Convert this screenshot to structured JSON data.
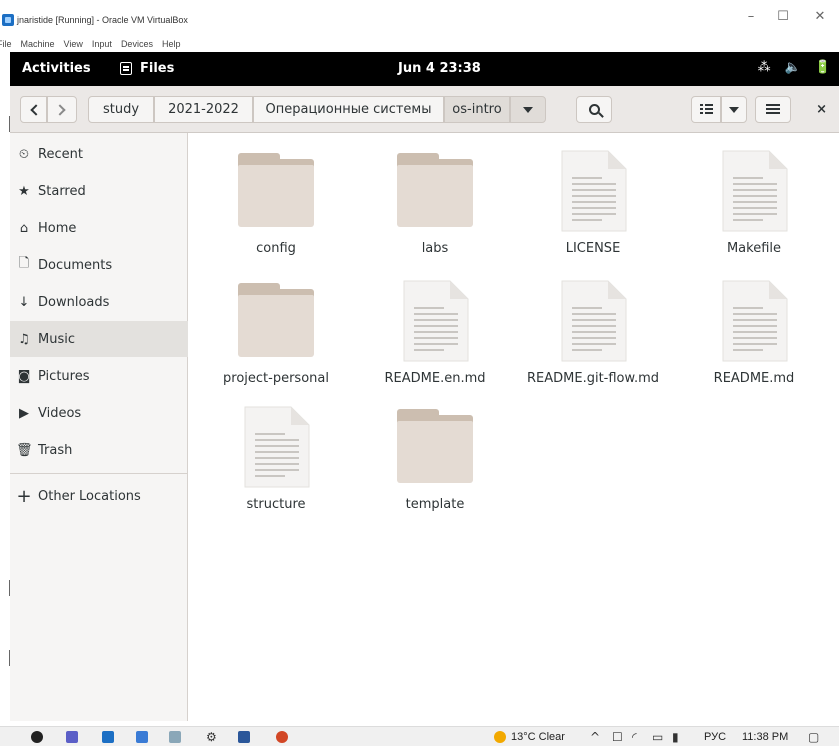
{
  "vbox": {
    "title": "jnaristide [Running] - Oracle VM VirtualBox",
    "menu": [
      "File",
      "Machine",
      "View",
      "Input",
      "Devices",
      "Help"
    ],
    "minimize": "–",
    "maximize": "☐",
    "close": "✕"
  },
  "topbar": {
    "activities": "Activities",
    "app": "Files",
    "clock": "Jun 4  23:38",
    "tray": {
      "network": "⁂",
      "volume": "🔈",
      "power": "🔋"
    }
  },
  "headerbar": {
    "back": "<",
    "forward": ">",
    "breadcrumbs": [
      "study",
      "2021-2022",
      "Операционные системы",
      "os-intro"
    ],
    "close": "×"
  },
  "sidebar": {
    "items": [
      {
        "label": "Recent",
        "icon": "clock-icon",
        "glyph": "⏲"
      },
      {
        "label": "Starred",
        "icon": "star-icon",
        "glyph": "★"
      },
      {
        "label": "Home",
        "icon": "home-icon",
        "glyph": "⌂"
      },
      {
        "label": "Documents",
        "icon": "document-icon",
        "glyph": "🗋"
      },
      {
        "label": "Downloads",
        "icon": "download-icon",
        "glyph": "↓"
      },
      {
        "label": "Music",
        "icon": "music-icon",
        "glyph": "♫"
      },
      {
        "label": "Pictures",
        "icon": "camera-icon",
        "glyph": "◙"
      },
      {
        "label": "Videos",
        "icon": "video-icon",
        "glyph": "▶"
      },
      {
        "label": "Trash",
        "icon": "trash-icon",
        "glyph": "🗑"
      }
    ],
    "other": {
      "label": "Other Locations",
      "icon": "plus-icon",
      "glyph": "+"
    },
    "active_index": 5
  },
  "files": [
    {
      "name": "config",
      "kind": "folder"
    },
    {
      "name": "labs",
      "kind": "folder"
    },
    {
      "name": "LICENSE",
      "kind": "document"
    },
    {
      "name": "Makefile",
      "kind": "document"
    },
    {
      "name": "project-personal",
      "kind": "folder"
    },
    {
      "name": "README.en.md",
      "kind": "document"
    },
    {
      "name": "README.git-flow.md",
      "kind": "document"
    },
    {
      "name": "README.md",
      "kind": "document"
    },
    {
      "name": "structure",
      "kind": "document"
    },
    {
      "name": "template",
      "kind": "folder"
    }
  ],
  "taskbar": {
    "weather": "13°C  Clear",
    "lang": "РУС",
    "time": "11:38 PM",
    "chevron": "^"
  },
  "colors": {
    "folder_front": "#e4dbd3",
    "folder_back": "#ccbeb0",
    "topbar": "#000000",
    "headerbar": "#ebe8e6",
    "sidebar": "#f6f5f4"
  }
}
